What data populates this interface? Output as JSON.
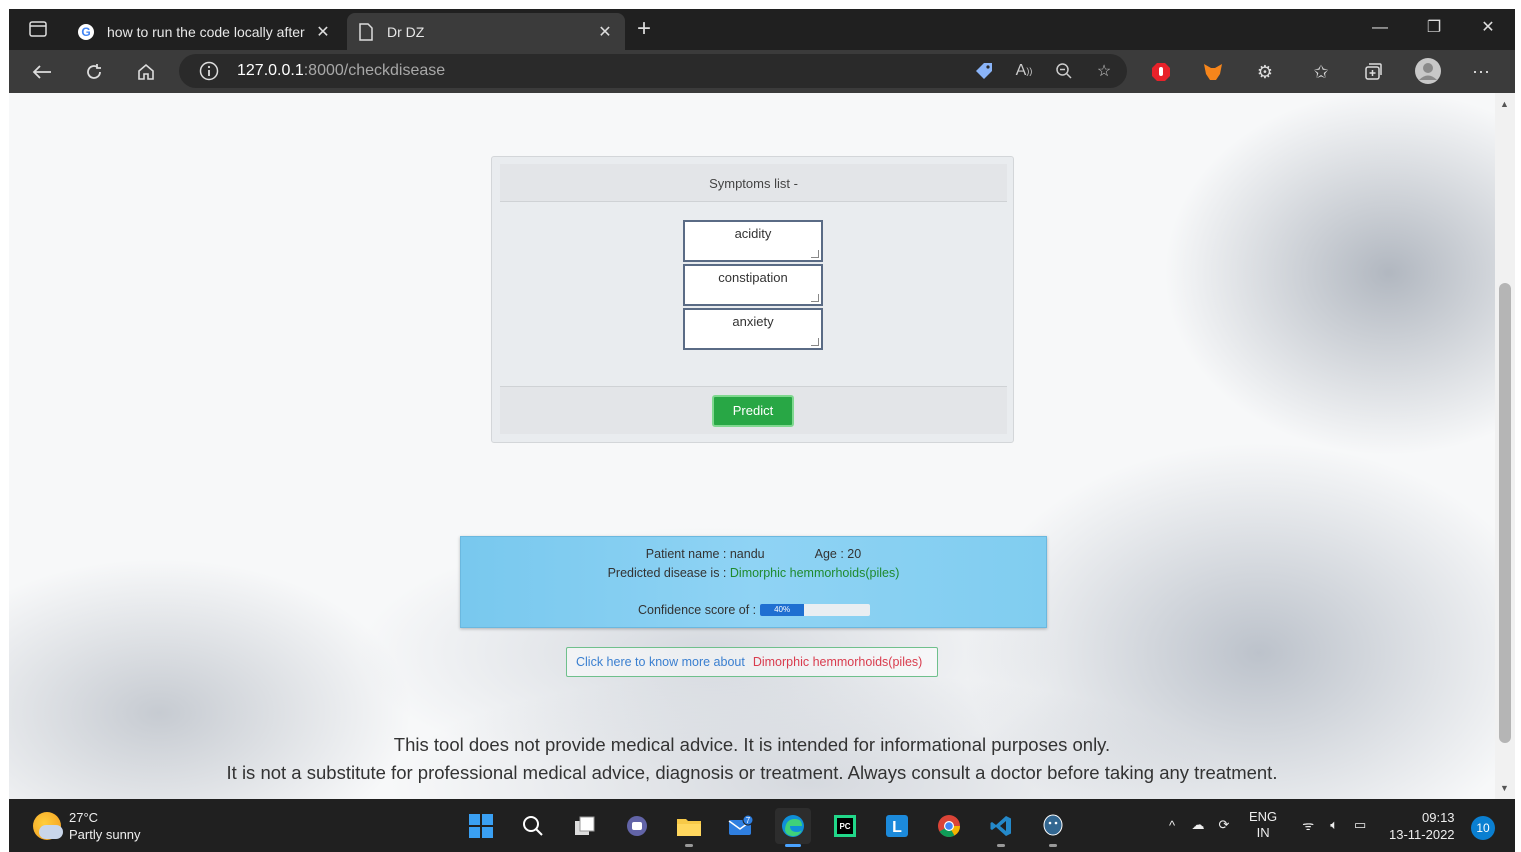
{
  "browser": {
    "tabs": [
      {
        "title": "how to run the code locally after",
        "active": false
      },
      {
        "title": "Dr DZ",
        "active": true
      }
    ],
    "url_host": "127.0.0.1",
    "url_rest": ":8000/checkdisease",
    "new_tab_symbol": "+",
    "close_symbol": "✕",
    "win_min": "—",
    "win_restore": "❐",
    "win_close": "✕"
  },
  "card": {
    "header": "Symptoms list -",
    "symptoms": [
      "acidity",
      "constipation",
      "anxiety"
    ],
    "predict_label": "Predict"
  },
  "result": {
    "patient_label": "Patient name : nandu",
    "age_label": "Age : 20",
    "predicted_prefix": "Predicted disease is :",
    "disease": "Dimorphic hemmorhoids(piles)",
    "confidence_label": "Confidence score of :",
    "confidence_text": "40%",
    "confidence_value": 0.4,
    "bar_color": "#1f6fd1"
  },
  "learn_more": {
    "prefix": "Click here to know more about",
    "disease": "Dimorphic hemmorhoids(piles)"
  },
  "disclaimer": {
    "line1": "This tool does not provide medical advice. It is intended for informational purposes only.",
    "line2": "It is not a substitute for professional medical advice, diagnosis or treatment. Always consult a doctor before taking any treatment."
  },
  "taskbar": {
    "weather_temp": "27°C",
    "weather_desc": "Partly sunny",
    "lang_top": "ENG",
    "lang_bottom": "IN",
    "time": "09:13",
    "date": "13-11-2022",
    "notifications": "10",
    "mail_badge": "7"
  },
  "colors": {
    "predict_button": "#28a745",
    "result_panel": "#8fd3f4",
    "disease_text": "#1e8a2e",
    "link_text": "#3a7fd0",
    "link_disease": "#d93c4e"
  }
}
